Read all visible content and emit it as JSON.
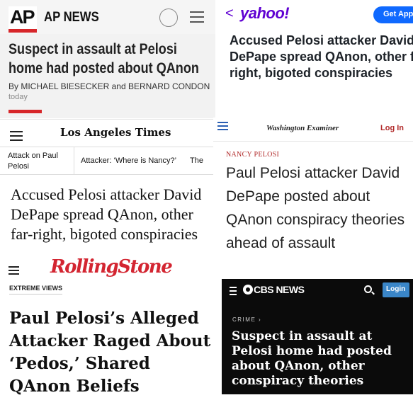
{
  "ap": {
    "logo": "AP",
    "brand": "AP NEWS",
    "headline": "Suspect in assault at Pelosi home had posted about QAnon",
    "byline": "By MICHAEL BIESECKER and BERNARD CONDON",
    "date": "today",
    "accent_color": "#d7262a"
  },
  "yahoo": {
    "back": "<",
    "logo": "yahoo!",
    "app_button": "Get App",
    "headline": "Accused Pelosi attacker David DePape spread QAnon, other far-right, bigoted conspiracies",
    "brand_color": "#6001d2"
  },
  "latimes": {
    "brand": "Los Angeles Times",
    "topics": [
      "Attack on Paul Pelosi",
      "Attacker: ‘Where is Nancy?’",
      "The"
    ],
    "headline": "Accused Pelosi attacker David DePape spread QAnon, other far-right, bigoted conspiracies"
  },
  "examiner": {
    "brand": "Washington Examiner",
    "login": "Log In",
    "tag": "NANCY PELOSI",
    "headline": "Paul Pelosi attacker David DePape posted about QAnon conspiracy theories ahead of assault"
  },
  "rollingstone": {
    "brand": "RollingStone",
    "tag": "EXTREME VIEWS",
    "headline": "Paul Pelosi’s Alleged Attacker Raged About ‘Pedos,’ Shared QAnon Beliefs",
    "brand_color": "#d32531"
  },
  "cbs": {
    "brand": "CBS NEWS",
    "login": "Login",
    "tag": "CRIME ›",
    "headline": "Suspect in assault at Pelosi home had posted about QAnon, other conspiracy theories"
  }
}
